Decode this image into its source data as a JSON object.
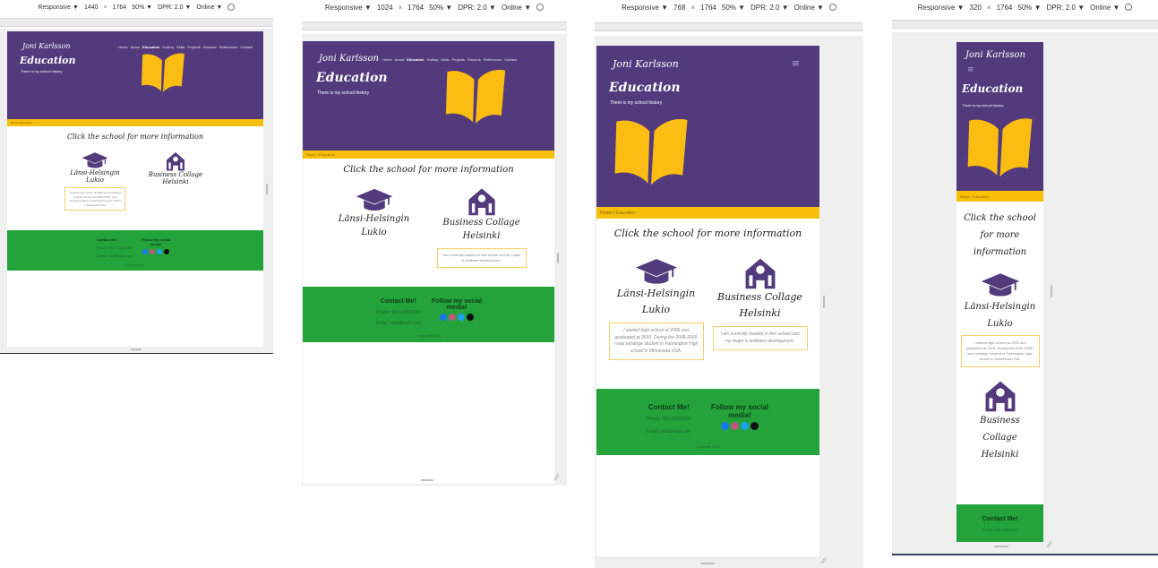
{
  "toolbar": {
    "device": "Responsive ▼",
    "times": "×",
    "height": "1764",
    "dpr": "DPR: 2.0 ▼",
    "network": "Online ▼",
    "viewports": [
      {
        "width": "1440",
        "zoom": "50% ▼",
        "dpr": "DPR: 2.0 ▼"
      },
      {
        "width": "1024",
        "zoom": "50% ▼",
        "dpr": "DPR: 2.0 ▼"
      },
      {
        "width": "768",
        "zoom": "50% ▼",
        "dpr": "DPR: 2.0 ▼"
      },
      {
        "width": "320",
        "zoom": "50% ▼",
        "dpr": "DPR: 2.0 ▼"
      }
    ]
  },
  "site": {
    "brand": "Joni Karlsson",
    "nav": [
      "Home",
      "About",
      "Education",
      "Gallery",
      "Skills",
      "Projects",
      "Resume",
      "References",
      "Contact"
    ],
    "active_nav": "Education",
    "page_title": "Education",
    "subtitle": "There is my school history",
    "breadcrumb": "Home / Education",
    "heading": "Click the school for more information",
    "heading_narrow": [
      "Click the school",
      "for more",
      "information"
    ],
    "schools": [
      {
        "name_lines": [
          "Länsi-Helsingin",
          "Lukio"
        ],
        "icon": "graduation-cap-icon",
        "info": "I started high-school at 2006 and graduated at 2010. During the 2008-2009 I was exhange student in Farmington High school in Minnesota USA."
      },
      {
        "name_lines": [
          "Business Collage",
          "Helsinki"
        ],
        "icon": "school-building-icon",
        "info": "I am currently student in this school and my major is software development."
      }
    ],
    "school2_narrow_lines": [
      "Business",
      "Collage",
      "Helsinki"
    ],
    "footer": {
      "contact_heading": "Contact Me!",
      "phone": "Phone: 050 00000000",
      "email": "Email: mail@mail.com",
      "social_heading_lines": [
        "Follow my social",
        "media!"
      ],
      "social_icons": [
        "facebook-icon",
        "instagram-icon",
        "twitter-icon",
        "github-icon"
      ],
      "copyright": "Copyright 2021"
    }
  },
  "colors": {
    "hero": "#523a7c",
    "accent": "#f7bf09",
    "footer": "#24a33a",
    "book": "#fbbd12"
  }
}
